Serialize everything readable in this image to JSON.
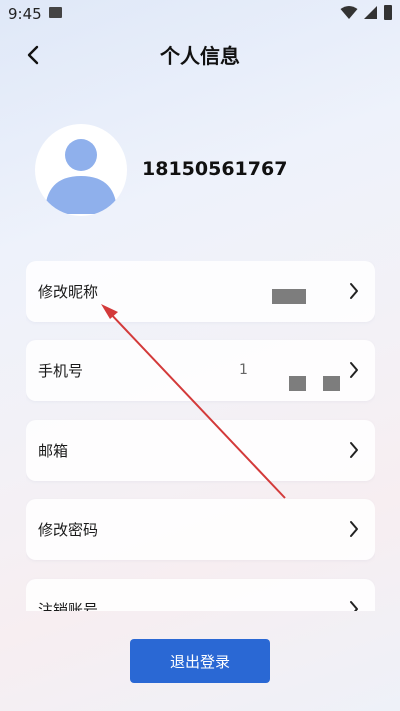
{
  "status_bar": {
    "time": "9:45"
  },
  "header": {
    "title": "个人信息"
  },
  "profile": {
    "phone": "18150561767"
  },
  "menu": {
    "items": [
      {
        "label": "修改昵称"
      },
      {
        "label": "手机号",
        "value": "1"
      },
      {
        "label": "邮箱"
      },
      {
        "label": "修改密码"
      },
      {
        "label": "注销账号"
      }
    ]
  },
  "logout": {
    "label": "退出登录"
  },
  "colors": {
    "primary": "#2a68d4",
    "avatar": "#8fb0ec",
    "annotation": "#d33a3a"
  },
  "icons": [
    "back-icon",
    "chevron-right-icon",
    "avatar-icon",
    "wifi-icon",
    "signal-icon",
    "battery-icon"
  ]
}
